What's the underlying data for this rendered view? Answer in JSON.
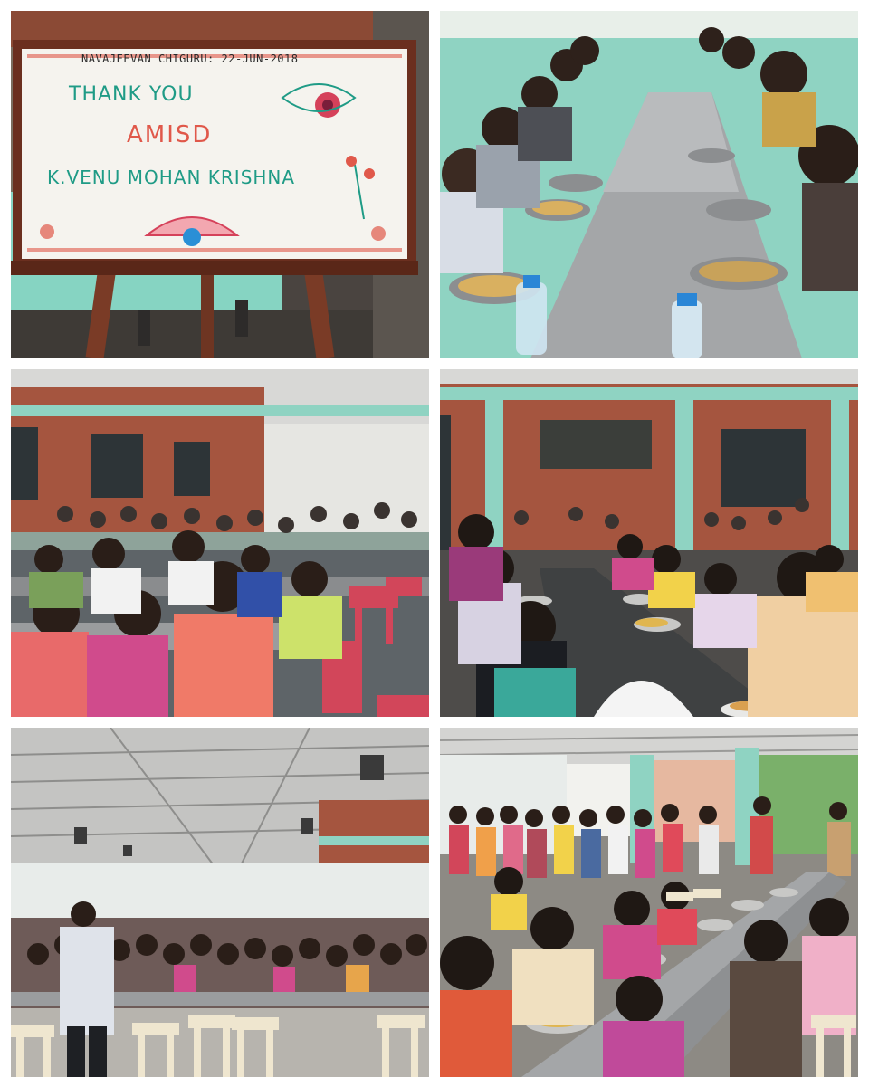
{
  "collage": {
    "photos": [
      {
        "subject": "whiteboard-on-easel"
      },
      {
        "subject": "children-eating-at-steel-table"
      },
      {
        "subject": "boys-dining-hall"
      },
      {
        "subject": "girls-dining-hall"
      },
      {
        "subject": "large-dining-hall-wide-view"
      },
      {
        "subject": "open-dining-hall-with-students"
      }
    ]
  },
  "whiteboard": {
    "header": "NAVAJEEVAN  CHIGURU:  22-JUN-2018",
    "line1": "THANK YOU",
    "line2": "AMISD",
    "line3": "K.VENU MOHAN KRISHNA"
  },
  "colors": {
    "board_teal_text": "#1f9b86",
    "board_red_text": "#e0584a",
    "brick": "#a5553f",
    "wall_teal": "#8fd3c2",
    "steel_table": "#9a9c9e",
    "stool_red": "#d2465a",
    "stool_cream": "#efe6cf"
  }
}
